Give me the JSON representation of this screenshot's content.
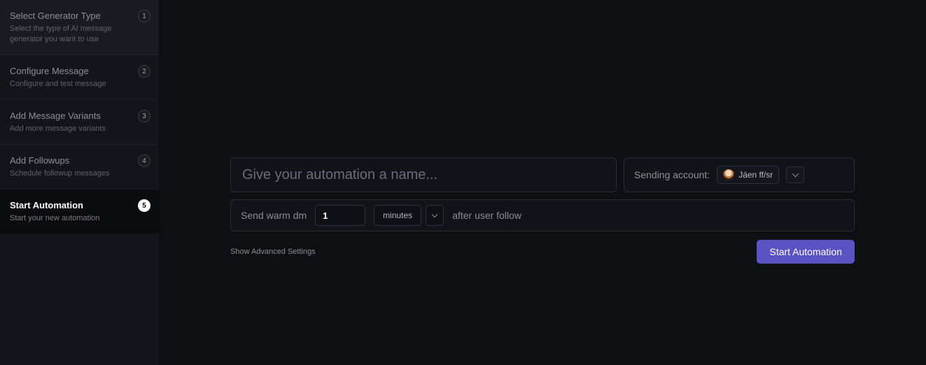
{
  "sidebar": {
    "steps": [
      {
        "num": "1",
        "title": "Select Generator Type",
        "desc": "Select the type of AI message generator you want to use"
      },
      {
        "num": "2",
        "title": "Configure Message",
        "desc": "Configure and test message"
      },
      {
        "num": "3",
        "title": "Add Message Variants",
        "desc": "Add more message variants"
      },
      {
        "num": "4",
        "title": "Add Followups",
        "desc": "Schedule followup messages"
      },
      {
        "num": "5",
        "title": "Start Automation",
        "desc": "Start your new automation"
      }
    ],
    "active_index": 4
  },
  "main": {
    "name_placeholder": "Give your automation a name...",
    "sending_label": "Sending account:",
    "account_name": "Jáen ff/sr",
    "schedule_prefix": "Send warm dm",
    "delay_value": "1",
    "delay_unit": "minutes",
    "schedule_suffix": "after user follow",
    "advanced_link": "Show Advanced Settings",
    "start_button": "Start Automation"
  }
}
